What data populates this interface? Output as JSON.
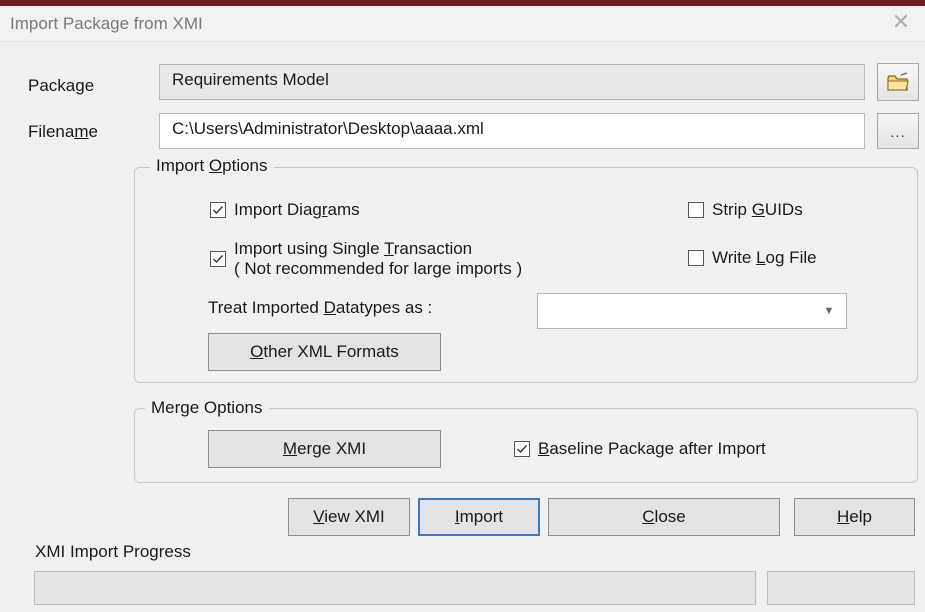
{
  "window": {
    "title": "Import Package from XMI",
    "close_glyph": "✕"
  },
  "package": {
    "label_html": "Package",
    "value": "Requirements Model",
    "browse_icon": "folder-icon"
  },
  "filename": {
    "label_pre": "Filena",
    "label_u": "m",
    "label_post": "e",
    "value": "C:\\Users\\Administrator\\Desktop\\aaaa.xml",
    "browse_label": "..."
  },
  "import_options": {
    "legend_pre": "Import ",
    "legend_u": "O",
    "legend_post": "ptions",
    "import_diagrams": {
      "pre": "Import Diag",
      "u": "r",
      "post": "ams",
      "checked": true
    },
    "single_transaction": {
      "pre": "Import using Single ",
      "u": "T",
      "post": "ransaction",
      "sub": "( Not recommended for large imports )",
      "checked": true
    },
    "strip_guids": {
      "pre": "Strip ",
      "u": "G",
      "post": "UIDs",
      "checked": false
    },
    "write_log": {
      "pre": "Write ",
      "u": "L",
      "post": "og File",
      "checked": false
    },
    "datatypes_label_pre": "Treat Imported ",
    "datatypes_label_u": "D",
    "datatypes_label_post": "atatypes as :",
    "datatypes_value": "",
    "other_formats": {
      "u": "O",
      "post": "ther XML Formats"
    }
  },
  "merge_options": {
    "legend": "Merge Options",
    "merge_button": {
      "u": "M",
      "post": "erge XMI"
    },
    "baseline": {
      "u": "B",
      "post": "aseline Package after Import",
      "checked": true
    }
  },
  "buttons": {
    "view_xmi": {
      "u": "V",
      "post": "iew XMI"
    },
    "import": {
      "u": "I",
      "post": "mport"
    },
    "close": {
      "u": "C",
      "post": "lose"
    },
    "help": {
      "u": "H",
      "post": "elp"
    }
  },
  "progress": {
    "label": "XMI Import Progress",
    "fraction": 0
  },
  "colors": {
    "top_band": "#6b1f1f",
    "dialog_bg": "#f1f1f1",
    "default_button_border": "#3b78c8"
  }
}
